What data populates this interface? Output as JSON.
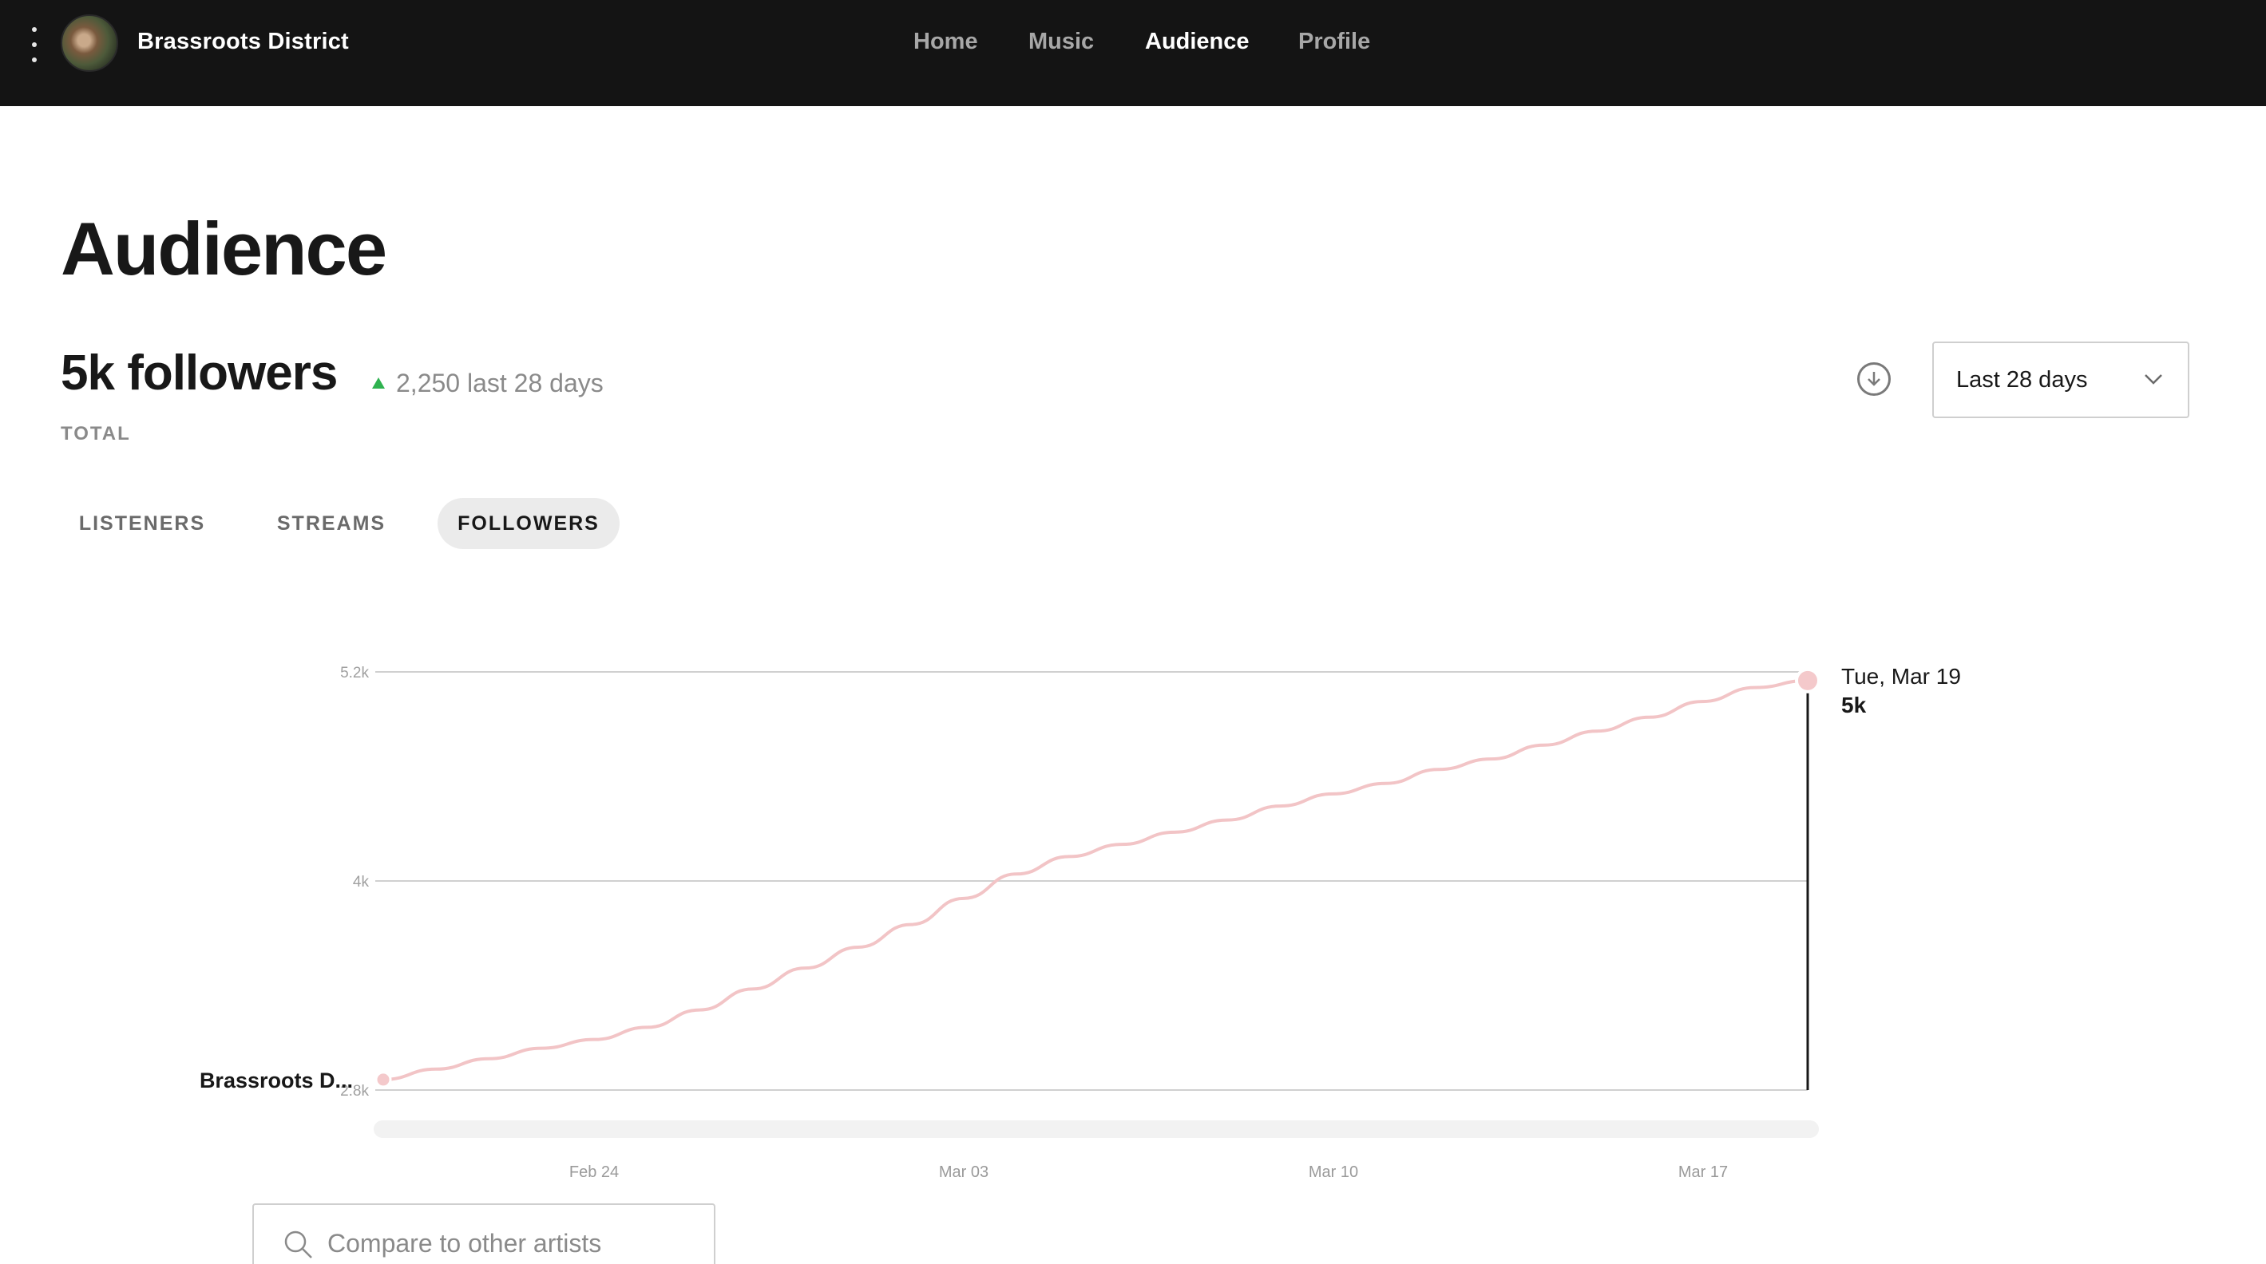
{
  "header": {
    "artist_name": "Brassroots District",
    "nav": [
      {
        "label": "Home",
        "active": false
      },
      {
        "label": "Music",
        "active": false
      },
      {
        "label": "Audience",
        "active": true
      },
      {
        "label": "Profile",
        "active": false
      }
    ]
  },
  "page": {
    "title": "Audience",
    "total": "5k followers",
    "delta": "2,250 last 28 days",
    "total_label": "TOTAL",
    "range": "Last 28 days"
  },
  "tabs": [
    {
      "label": "LISTENERS",
      "active": false
    },
    {
      "label": "STREAMS",
      "active": false
    },
    {
      "label": "FOLLOWERS",
      "active": true
    }
  ],
  "colors": {
    "accent_line": "#f2c4c6",
    "delta_up": "#2eb24f",
    "topbar": "#141414"
  },
  "chart_data": {
    "type": "line",
    "y_ticks": [
      "5.2k",
      "4k",
      "2.8k"
    ],
    "y_tick_values": [
      5200,
      4000,
      2800
    ],
    "ylim": [
      2800,
      5200
    ],
    "x_ticks": [
      "Feb 24",
      "Mar 03",
      "Mar 10",
      "Mar 17"
    ],
    "series": [
      {
        "name": "Brassroots D...",
        "values": [
          2860,
          2920,
          2980,
          3040,
          3090,
          3160,
          3260,
          3380,
          3500,
          3620,
          3750,
          3900,
          4040,
          4140,
          4210,
          4280,
          4350,
          4430,
          4500,
          4560,
          4640,
          4700,
          4780,
          4860,
          4940,
          5030,
          5110,
          5150
        ]
      }
    ],
    "tooltip": {
      "date": "Tue, Mar 19",
      "value": "5k"
    }
  },
  "compare": {
    "placeholder": "Compare to other artists"
  }
}
